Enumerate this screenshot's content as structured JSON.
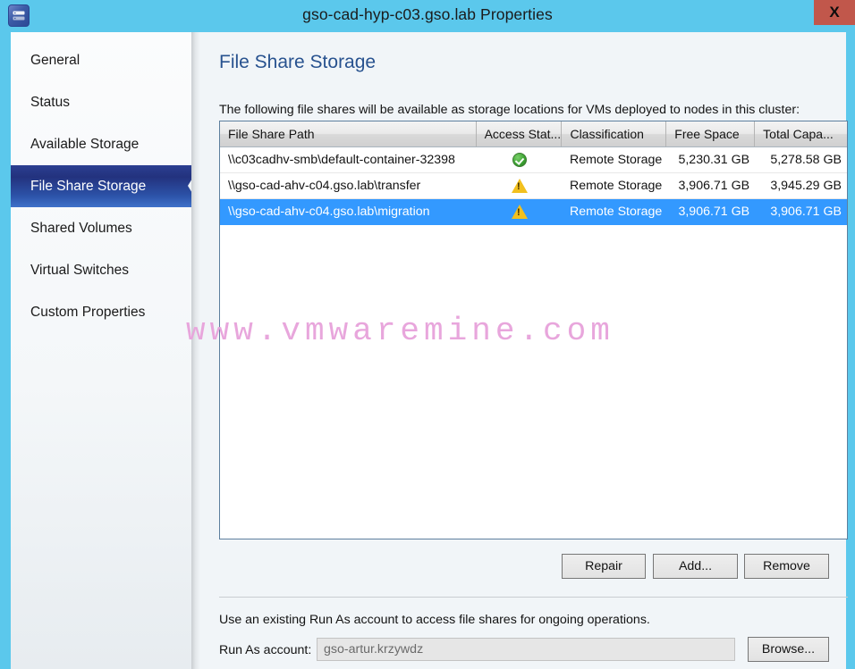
{
  "window": {
    "title": "gso-cad-hyp-c03.gso.lab Properties",
    "close_label": "X",
    "app_icon": "server-cluster-icon",
    "titlebar_color": "#5bc8ec",
    "close_button_color": "#c1574b"
  },
  "sidebar": {
    "items": [
      {
        "label": "General",
        "selected": false
      },
      {
        "label": "Status",
        "selected": false
      },
      {
        "label": "Available Storage",
        "selected": false
      },
      {
        "label": "File Share Storage",
        "selected": true
      },
      {
        "label": "Shared Volumes",
        "selected": false
      },
      {
        "label": "Virtual Switches",
        "selected": false
      },
      {
        "label": "Custom Properties",
        "selected": false
      }
    ],
    "selected_accent": "#23327e"
  },
  "main": {
    "page_title": "File Share Storage",
    "page_title_color": "#28528f",
    "intro": "The following file shares will be available as storage locations for VMs deployed to nodes in this cluster:",
    "table": {
      "columns": [
        "File Share Path",
        "Access Stat...",
        "Classification",
        "Free Space",
        "Total Capa..."
      ],
      "rows": [
        {
          "path": "\\\\c03cadhv-smb\\default-container-32398",
          "access_status": "ok",
          "classification": "Remote Storage",
          "free_space": "5,230.31 GB",
          "total_capacity": "5,278.58 GB",
          "selected": false
        },
        {
          "path": "\\\\gso-cad-ahv-c04.gso.lab\\transfer",
          "access_status": "warning",
          "classification": "Remote Storage",
          "free_space": "3,906.71 GB",
          "total_capacity": "3,945.29 GB",
          "selected": false
        },
        {
          "path": "\\\\gso-cad-ahv-c04.gso.lab\\migration",
          "access_status": "warning",
          "classification": "Remote Storage",
          "free_space": "3,906.71 GB",
          "total_capacity": "3,906.71 GB",
          "selected": true
        }
      ],
      "selection_color": "#3399ff"
    },
    "buttons": {
      "repair": "Repair",
      "add": "Add...",
      "remove": "Remove",
      "browse": "Browse..."
    },
    "runas": {
      "help": "Use an existing Run As account to access file shares for ongoing operations.",
      "label": "Run As account:",
      "value": "gso-artur.krzywdz"
    }
  },
  "watermark": {
    "text": "www.vmwaremine.com",
    "color": "#e8a6dc"
  }
}
